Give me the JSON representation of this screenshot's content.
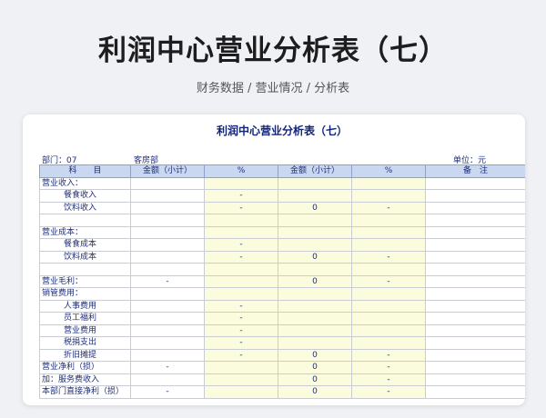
{
  "header": {
    "title": "利润中心营业分析表（七）",
    "subtitle": "财务数据 / 营业情况 / 分析表"
  },
  "sheet": {
    "title": "利润中心营业分析表（七）",
    "dept_label": "部门：07",
    "dept_name": "客房部",
    "unit_label": "单位：元",
    "columns": [
      "科　　目",
      "金额（小计）",
      "%",
      "金额（小计）",
      "%",
      "备　注"
    ],
    "rows": [
      {
        "label": "营业收入：",
        "indent": false,
        "amt": "",
        "pct": "",
        "amt2": "",
        "pct2": "",
        "note": ""
      },
      {
        "label": "餐食收入",
        "indent": true,
        "amt": "",
        "pct": "-",
        "amt2": "",
        "pct2": "",
        "note": ""
      },
      {
        "label": "饮料收入",
        "indent": true,
        "amt": "",
        "pct": "-",
        "amt2": "0",
        "pct2": "-",
        "note": ""
      },
      {
        "label": "",
        "indent": false,
        "amt": "",
        "pct": "",
        "amt2": "",
        "pct2": "",
        "note": ""
      },
      {
        "label": "营业成本：",
        "indent": false,
        "amt": "",
        "pct": "",
        "amt2": "",
        "pct2": "",
        "note": ""
      },
      {
        "label": "餐食成本",
        "indent": true,
        "amt": "",
        "pct": "-",
        "amt2": "",
        "pct2": "",
        "note": ""
      },
      {
        "label": "饮料成本",
        "indent": true,
        "amt": "",
        "pct": "-",
        "amt2": "0",
        "pct2": "-",
        "note": ""
      },
      {
        "label": "",
        "indent": false,
        "amt": "",
        "pct": "",
        "amt2": "",
        "pct2": "",
        "note": ""
      },
      {
        "label": "营业毛利：",
        "indent": false,
        "amt": "-",
        "pct": "",
        "amt2": "0",
        "pct2": "-",
        "note": ""
      },
      {
        "label": "销管费用：",
        "indent": false,
        "amt": "",
        "pct": "",
        "amt2": "",
        "pct2": "",
        "note": ""
      },
      {
        "label": "人事费用",
        "indent": true,
        "amt": "",
        "pct": "-",
        "amt2": "",
        "pct2": "",
        "note": ""
      },
      {
        "label": "员工福利",
        "indent": true,
        "amt": "",
        "pct": "-",
        "amt2": "",
        "pct2": "",
        "note": ""
      },
      {
        "label": "营业费用",
        "indent": true,
        "amt": "",
        "pct": "-",
        "amt2": "",
        "pct2": "",
        "note": ""
      },
      {
        "label": "税捐支出",
        "indent": true,
        "amt": "",
        "pct": "-",
        "amt2": "",
        "pct2": "",
        "note": ""
      },
      {
        "label": "折旧摊提",
        "indent": true,
        "amt": "",
        "pct": "-",
        "amt2": "0",
        "pct2": "-",
        "note": ""
      },
      {
        "label": "营业净利（损）",
        "indent": false,
        "amt": "-",
        "pct": "",
        "amt2": "0",
        "pct2": "-",
        "note": ""
      },
      {
        "label": "加：服务费收入",
        "indent": false,
        "amt": "",
        "pct": "",
        "amt2": "0",
        "pct2": "-",
        "note": ""
      },
      {
        "label": "本部门直接净利（损）",
        "indent": false,
        "amt": "-",
        "pct": "",
        "amt2": "0",
        "pct2": "-",
        "note": ""
      }
    ]
  }
}
